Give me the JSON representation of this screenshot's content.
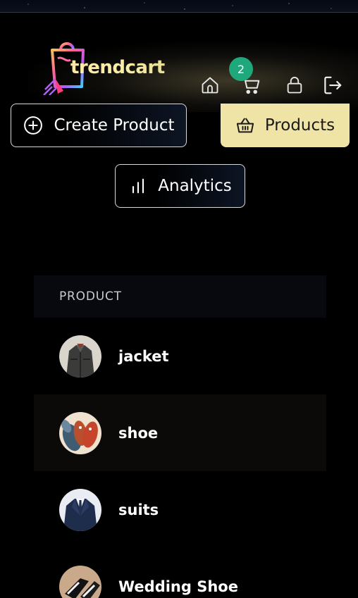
{
  "brand": {
    "name": "trendcart"
  },
  "header": {
    "cart_count": "2",
    "icons": [
      "home-icon",
      "cart-icon",
      "lock-icon",
      "logout-icon"
    ]
  },
  "tabs": {
    "create_label": "Create Product",
    "products_label": "Products",
    "analytics_label": "Analytics"
  },
  "colors": {
    "active_tab": "#efe3a6",
    "badge": "#1fa87c",
    "background": "#000000"
  },
  "table": {
    "header": "PRODUCT",
    "rows": [
      {
        "name": "jacket"
      },
      {
        "name": "shoe"
      },
      {
        "name": "suits"
      },
      {
        "name": "Wedding Shoe"
      }
    ]
  }
}
